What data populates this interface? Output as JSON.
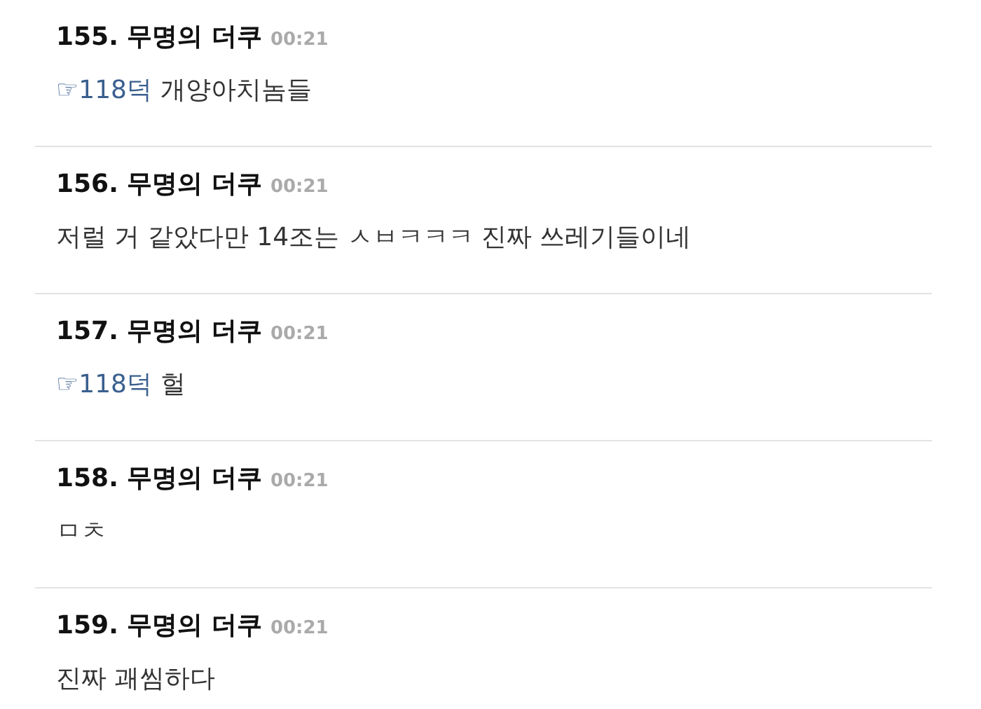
{
  "comments": [
    {
      "title": "155. 무명의 더쿠",
      "time": "00:21",
      "reply_link": "☞118덕",
      "text": "개양아치놈들"
    },
    {
      "title": "156. 무명의 더쿠",
      "time": "00:21",
      "text": "저럴 거 같았다만 14조는 ㅅㅂㅋㅋㅋ 진짜 쓰레기들이네"
    },
    {
      "title": "157. 무명의 더쿠",
      "time": "00:21",
      "reply_link": "☞118덕",
      "text": "헐"
    },
    {
      "title": "158. 무명의 더쿠",
      "time": "00:21",
      "text": "ㅁㅊ"
    },
    {
      "title": "159. 무명의 더쿠",
      "time": "00:21",
      "text": "진짜 괘씸하다"
    }
  ]
}
